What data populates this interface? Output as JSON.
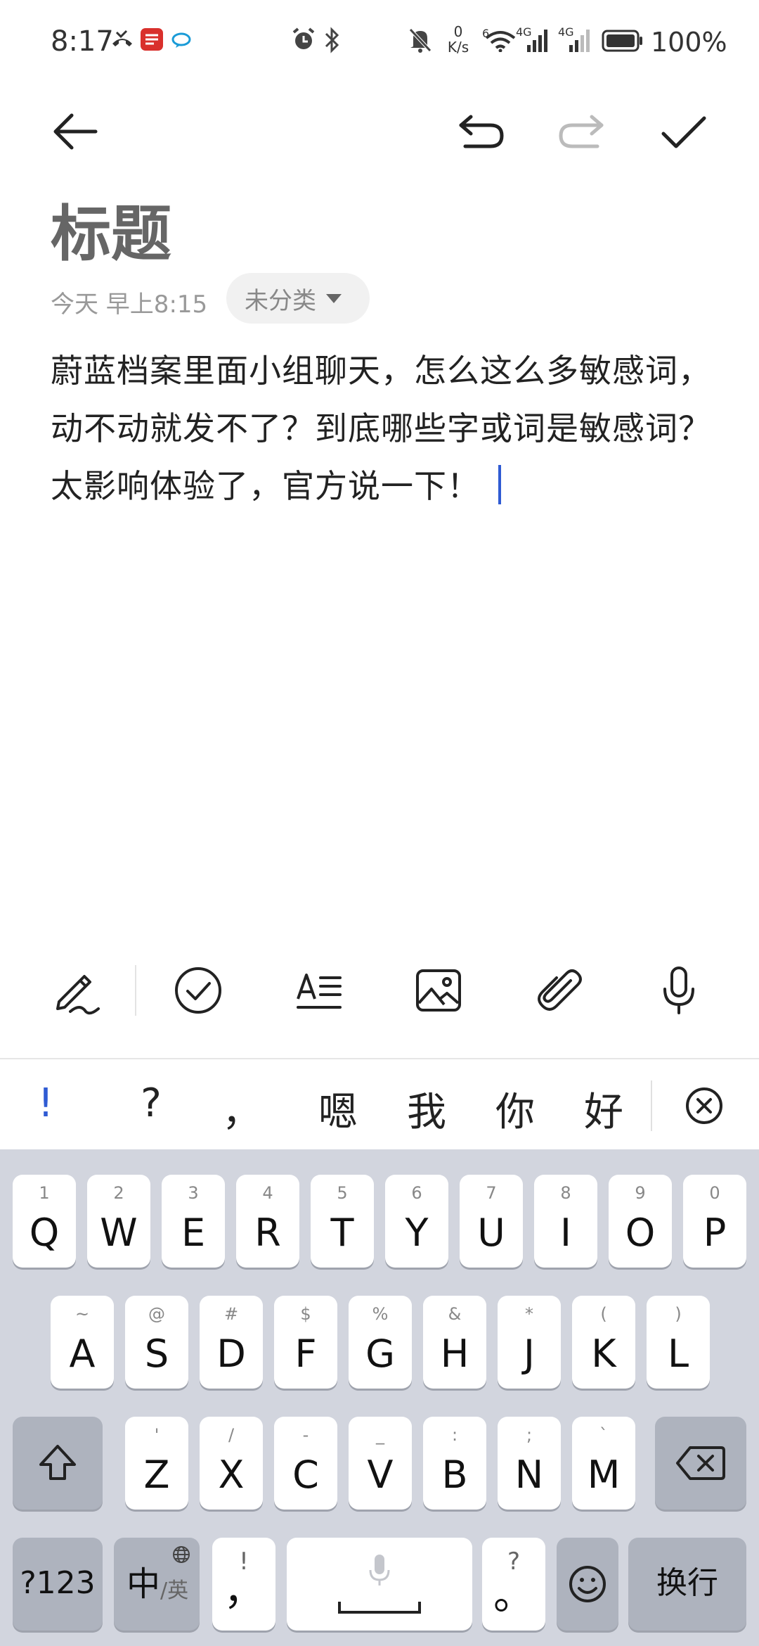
{
  "status_bar": {
    "time": "8:17",
    "net_speed_value": "0",
    "net_speed_unit": "K/s",
    "net_6": "6",
    "net_4g_1": "4G",
    "net_4g_2": "4G",
    "battery": "100%",
    "icons": [
      "missed-call-icon",
      "app-notification-icon",
      "chat-icon",
      "alarm-icon",
      "bluetooth-icon",
      "mute-icon",
      "wifi-icon",
      "signal-icon",
      "battery-icon"
    ]
  },
  "toolbar": {
    "back_icon": "arrow-left-icon",
    "undo_icon": "undo-icon",
    "redo_icon": "redo-icon",
    "done_icon": "checkmark-icon"
  },
  "note": {
    "title": "标题",
    "date": "今天 早上8:15",
    "category": "未分类",
    "body": "蔚蓝档案里面小组聊天，怎么这么多敏感词，动不动就发不了？到底哪些字或词是敏感词？太影响体验了，官方说一下！"
  },
  "format_toolbar": {
    "icons": [
      "handwriting-icon",
      "checklist-icon",
      "text-format-icon",
      "image-icon",
      "attachment-icon",
      "microphone-icon"
    ]
  },
  "suggestions": {
    "items": [
      "!",
      "?",
      "，",
      "嗯",
      "我",
      "你",
      "好"
    ],
    "close_icon": "close-circle-icon"
  },
  "keyboard": {
    "row1": [
      {
        "key": "Q",
        "hint": "1"
      },
      {
        "key": "W",
        "hint": "2"
      },
      {
        "key": "E",
        "hint": "3"
      },
      {
        "key": "R",
        "hint": "4"
      },
      {
        "key": "T",
        "hint": "5"
      },
      {
        "key": "Y",
        "hint": "6"
      },
      {
        "key": "U",
        "hint": "7"
      },
      {
        "key": "I",
        "hint": "8"
      },
      {
        "key": "O",
        "hint": "9"
      },
      {
        "key": "P",
        "hint": "0"
      }
    ],
    "row2": [
      {
        "key": "A",
        "hint": "~"
      },
      {
        "key": "S",
        "hint": "@"
      },
      {
        "key": "D",
        "hint": "#"
      },
      {
        "key": "F",
        "hint": "$"
      },
      {
        "key": "G",
        "hint": "%"
      },
      {
        "key": "H",
        "hint": "&"
      },
      {
        "key": "J",
        "hint": "*"
      },
      {
        "key": "K",
        "hint": "("
      },
      {
        "key": "L",
        "hint": ")"
      }
    ],
    "row3": [
      {
        "key": "Z",
        "hint": "'"
      },
      {
        "key": "X",
        "hint": "/"
      },
      {
        "key": "C",
        "hint": "-"
      },
      {
        "key": "V",
        "hint": "_"
      },
      {
        "key": "B",
        "hint": ":"
      },
      {
        "key": "N",
        "hint": ";"
      },
      {
        "key": "M",
        "hint": "`"
      }
    ],
    "symbols_key": "?123",
    "lang_key_main": "中",
    "lang_key_sub": "/英",
    "comma_key": "，",
    "comma_hint": "!",
    "period_key": "。",
    "period_hint": "?",
    "enter_key": "换行"
  },
  "colors": {
    "accent": "#2f5bd3",
    "keyboard_bg": "#d2d5de",
    "dark_key": "#aeb3be"
  }
}
